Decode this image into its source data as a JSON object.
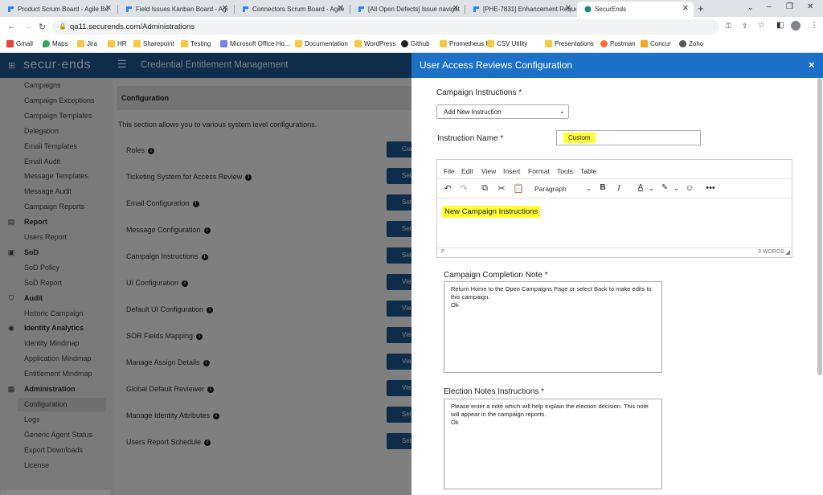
{
  "browser": {
    "tabs": [
      {
        "title": "Product Scrum Board - Agile Bo"
      },
      {
        "title": "Field Issues Kanban Board - Agi"
      },
      {
        "title": "Connectors Scrum Board - Agile"
      },
      {
        "title": "[All Open Defects] Issue navigat"
      },
      {
        "title": "[PHE-7831] Enhancement Reque"
      },
      {
        "title": "SecurEnds"
      }
    ],
    "url": "qa11.securends.com/Administrations",
    "bookmarks": [
      "Gmail",
      "Maps",
      "Jira",
      "HR",
      "Sharepoint",
      "Testing",
      "Microsoft Office Ho...",
      "Documentation",
      "WordPress",
      "Github",
      "Prometheus UI",
      "CSV Utility",
      "Presentations",
      "Postman",
      "Concur",
      "Zoho"
    ],
    "colors": {
      "tab_icon": "#2684ff",
      "active_tab_icon": "#1a8a7a"
    }
  },
  "app": {
    "logo": "secur·ends",
    "title": "Credential Entitlement Management",
    "header_color": "#1a5a96"
  },
  "sidebar": {
    "items": [
      {
        "label": "Campaigns",
        "type": "item"
      },
      {
        "label": "Campaign Exceptions",
        "type": "item"
      },
      {
        "label": "Campaign Templates",
        "type": "item"
      },
      {
        "label": "Delegation",
        "type": "item"
      },
      {
        "label": "Email Templates",
        "type": "item"
      },
      {
        "label": "Email Audit",
        "type": "item"
      },
      {
        "label": "Message Templates",
        "type": "item"
      },
      {
        "label": "Message Audit",
        "type": "item"
      },
      {
        "label": "Campaign Reports",
        "type": "item"
      },
      {
        "label": "Report",
        "type": "section",
        "icon": "report-icon"
      },
      {
        "label": "Users Report",
        "type": "item"
      },
      {
        "label": "SoD",
        "type": "section",
        "icon": "sod-icon"
      },
      {
        "label": "SoD Policy",
        "type": "item"
      },
      {
        "label": "SoD Report",
        "type": "item"
      },
      {
        "label": "Audit",
        "type": "section",
        "icon": "shield-icon"
      },
      {
        "label": "Historic Campaign",
        "type": "item"
      },
      {
        "label": "Identity Analytics",
        "type": "section",
        "icon": "analytics-icon"
      },
      {
        "label": "Identity Mindmap",
        "type": "item"
      },
      {
        "label": "Application Mindmap",
        "type": "item"
      },
      {
        "label": "Entitlement Mindmap",
        "type": "item"
      },
      {
        "label": "Administration",
        "type": "section",
        "icon": "admin-icon"
      },
      {
        "label": "Configuration",
        "type": "item",
        "active": true
      },
      {
        "label": "Logs",
        "type": "item"
      },
      {
        "label": "Generic Agent Status",
        "type": "item"
      },
      {
        "label": "Export Downloads",
        "type": "item"
      },
      {
        "label": "License",
        "type": "item"
      }
    ]
  },
  "main": {
    "section_title": "Configuration",
    "description": "This section allows you to various system level configurations.",
    "rows": [
      {
        "label": "Roles",
        "button": "Confi"
      },
      {
        "label": "Ticketing System for Access Review",
        "button": "Set"
      },
      {
        "label": "Email Configuration",
        "button": "Set"
      },
      {
        "label": "Message Configuration",
        "button": "Set"
      },
      {
        "label": "Campaign Instructions",
        "button": "Set"
      },
      {
        "label": "UI Configuration",
        "button": "Vie"
      },
      {
        "label": "Default UI Configuration",
        "button": "Vie"
      },
      {
        "label": "SOR Fields Mapping",
        "button": "Vie"
      },
      {
        "label": "Manage Assign Details",
        "button": "Vie"
      },
      {
        "label": "Global Default Reviewer",
        "button": "Vie"
      },
      {
        "label": "Manage Identity Attributes",
        "button": "Set"
      },
      {
        "label": "Users Report Schedule",
        "button": "Set"
      }
    ]
  },
  "panel": {
    "title": "User Access Reviews Configuration",
    "close": "×",
    "campaign_instructions_label": "Campaign Instructions *",
    "campaign_instructions_value": "Add New Instruction",
    "instruction_name_label": "Instruction Name *",
    "instruction_name_value": "Custom",
    "editor": {
      "menu": [
        "File",
        "Edit",
        "View",
        "Insert",
        "Format",
        "Tools",
        "Table"
      ],
      "block_format": "Paragraph",
      "content": "New Campaign Instructions",
      "path": "P",
      "word_count": "3 WORDS"
    },
    "completion_note_label": "Campaign Completion Note *",
    "completion_note_value": "Return Home to the Open Campaigns Page or select Back to make edits to this campaign.\nOk",
    "election_notes_label": "Election Notes Instructions *",
    "election_notes_value": "Please enter a note which will help explain the election decision. This note will appear in the campaign reports.\nOk",
    "header_color": "#1c70c8",
    "highlight_color": "#ffff33"
  }
}
